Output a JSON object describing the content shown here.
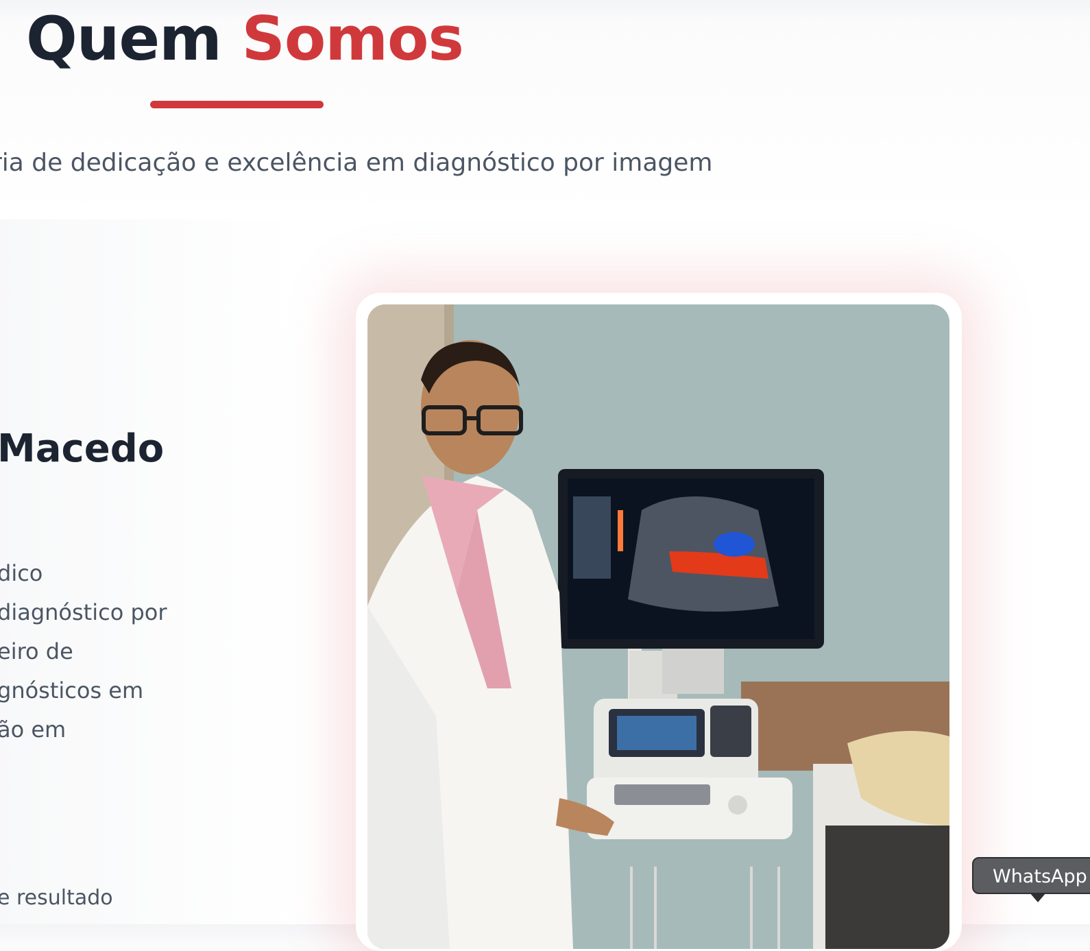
{
  "section": {
    "title_part1": "Quem",
    "title_part2": "Somos",
    "subtitle": "ria de dedicação e excelência em diagnóstico por imagem",
    "accent_color": "#d0393c",
    "heading_color": "#1c2431"
  },
  "profile": {
    "name": "Macedo",
    "bio_lines": [
      "dico",
      " diagnóstico por",
      "eiro de",
      "gnósticos em",
      "ão em"
    ],
    "bottom_text": "e resultado",
    "photo_icon": "doctor-ultrasound-photo"
  },
  "whatsapp": {
    "tooltip": "WhatsApp",
    "icon": "whatsapp-icon"
  }
}
